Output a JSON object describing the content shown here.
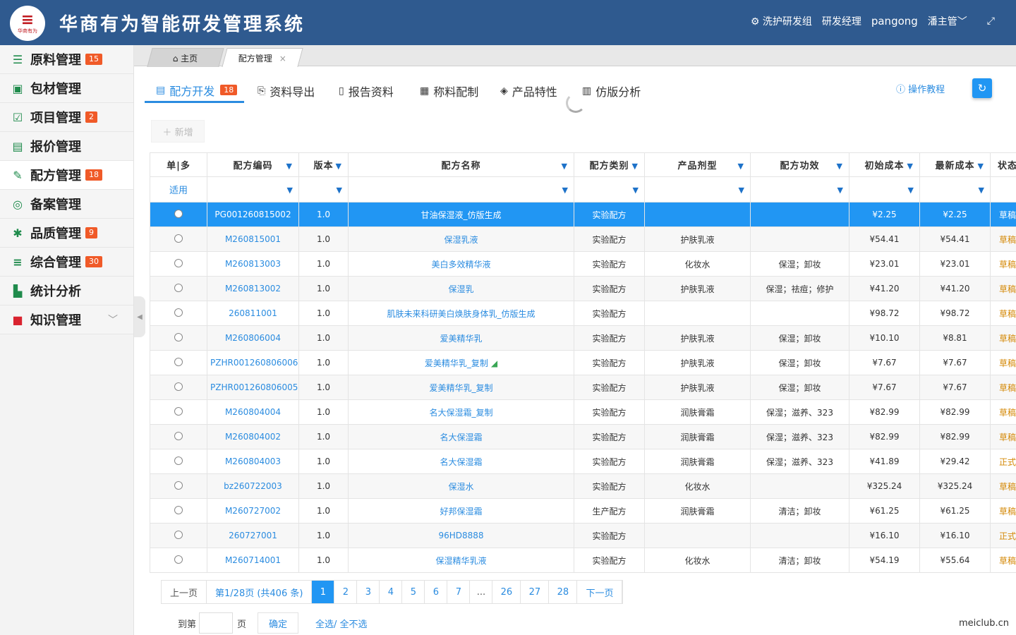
{
  "header": {
    "logo_text": "华商有为",
    "title": "华商有为智能研发管理系统",
    "group": "洗护研发组",
    "role": "研发经理",
    "username": "pangong",
    "supervisor": "潘主管"
  },
  "sidebar": {
    "items": [
      {
        "label": "原料管理",
        "badge": "15",
        "icon": "database-icon"
      },
      {
        "label": "包材管理",
        "badge": "",
        "icon": "gift-icon"
      },
      {
        "label": "项目管理",
        "badge": "2",
        "icon": "checkbox-icon"
      },
      {
        "label": "报价管理",
        "badge": "",
        "icon": "ledger-icon"
      },
      {
        "label": "配方管理",
        "badge": "18",
        "icon": "edit-icon"
      },
      {
        "label": "备案管理",
        "badge": "",
        "icon": "target-icon"
      },
      {
        "label": "品质管理",
        "badge": "9",
        "icon": "gear-icon"
      },
      {
        "label": "综合管理",
        "badge": "30",
        "icon": "list-icon"
      },
      {
        "label": "统计分析",
        "badge": "",
        "icon": "chart-icon"
      },
      {
        "label": "知识管理",
        "badge": "",
        "icon": "book-icon"
      }
    ]
  },
  "tabs": {
    "home": "主页",
    "current": "配方管理",
    "close": "×"
  },
  "subtabs": {
    "dev": "配方开发",
    "dev_badge": "18",
    "export": "资料导出",
    "report": "报告资料",
    "weigh": "称料配制",
    "feature": "产品特性",
    "imitate": "仿版分析",
    "tutorial": "操作教程"
  },
  "toolbar": {
    "add": "新增"
  },
  "table": {
    "columns": [
      "单|多",
      "配方编码",
      "版本",
      "配方名称",
      "配方类别",
      "产品剂型",
      "配方功效",
      "初始成本",
      "最新成本",
      "状态"
    ],
    "apply_label": "适用",
    "rows": [
      {
        "code": "PG001260815002",
        "ver": "1.0",
        "name": "甘油保湿液_仿版生成",
        "cat": "实验配方",
        "form": "",
        "effect": "",
        "init": "¥2.25",
        "latest": "¥2.25",
        "status": "草稿"
      },
      {
        "code": "M260815001",
        "ver": "1.0",
        "name": "保湿乳液",
        "cat": "实验配方",
        "form": "护肤乳液",
        "effect": "",
        "init": "¥54.41",
        "latest": "¥54.41",
        "status": "草稿"
      },
      {
        "code": "M260813003",
        "ver": "1.0",
        "name": "美白多效精华液",
        "cat": "实验配方",
        "form": "化妆水",
        "effect": "保湿；卸妆",
        "init": "¥23.01",
        "latest": "¥23.01",
        "status": "草稿"
      },
      {
        "code": "M260813002",
        "ver": "1.0",
        "name": "保湿乳",
        "cat": "实验配方",
        "form": "护肤乳液",
        "effect": "保湿；祛痘；修护",
        "init": "¥41.20",
        "latest": "¥41.20",
        "status": "草稿"
      },
      {
        "code": "260811001",
        "ver": "1.0",
        "name": "肌肤未来科研美白焕肤身体乳_仿版生成",
        "cat": "实验配方",
        "form": "",
        "effect": "",
        "init": "¥98.72",
        "latest": "¥98.72",
        "status": "草稿"
      },
      {
        "code": "M260806004",
        "ver": "1.0",
        "name": "爱美精华乳",
        "cat": "实验配方",
        "form": "护肤乳液",
        "effect": "保湿；卸妆",
        "init": "¥10.10",
        "latest": "¥8.81",
        "status": "草稿"
      },
      {
        "code": "PZHR001260806006",
        "ver": "1.0",
        "name": "爱美精华乳_复制",
        "cat": "实验配方",
        "form": "护肤乳液",
        "effect": "保湿；卸妆",
        "init": "¥7.67",
        "latest": "¥7.67",
        "status": "草稿",
        "edit": true
      },
      {
        "code": "PZHR001260806005",
        "ver": "1.0",
        "name": "爱美精华乳_复制",
        "cat": "实验配方",
        "form": "护肤乳液",
        "effect": "保湿；卸妆",
        "init": "¥7.67",
        "latest": "¥7.67",
        "status": "草稿"
      },
      {
        "code": "M260804004",
        "ver": "1.0",
        "name": "名大保湿霜_复制",
        "cat": "实验配方",
        "form": "润肤膏霜",
        "effect": "保湿；滋养、323",
        "init": "¥82.99",
        "latest": "¥82.99",
        "status": "草稿"
      },
      {
        "code": "M260804002",
        "ver": "1.0",
        "name": "名大保湿霜",
        "cat": "实验配方",
        "form": "润肤膏霜",
        "effect": "保湿；滋养、323",
        "init": "¥82.99",
        "latest": "¥82.99",
        "status": "草稿"
      },
      {
        "code": "M260804003",
        "ver": "1.0",
        "name": "名大保湿霜",
        "cat": "实验配方",
        "form": "润肤膏霜",
        "effect": "保湿；滋养、323",
        "init": "¥41.89",
        "latest": "¥29.42",
        "status": "正式"
      },
      {
        "code": "bz260722003",
        "ver": "1.0",
        "name": "保湿水",
        "cat": "实验配方",
        "form": "化妆水",
        "effect": "",
        "init": "¥325.24",
        "latest": "¥325.24",
        "status": "草稿"
      },
      {
        "code": "M260727002",
        "ver": "1.0",
        "name": "好邦保湿霜",
        "cat": "生产配方",
        "form": "润肤膏霜",
        "effect": "清洁；卸妆",
        "init": "¥61.25",
        "latest": "¥61.25",
        "status": "草稿"
      },
      {
        "code": "260727001",
        "ver": "1.0",
        "name": "96HD8888",
        "cat": "实验配方",
        "form": "",
        "effect": "",
        "init": "¥16.10",
        "latest": "¥16.10",
        "status": "正式"
      },
      {
        "code": "M260714001",
        "ver": "1.0",
        "name": "保湿精华乳液",
        "cat": "实验配方",
        "form": "化妆水",
        "effect": "清洁；卸妆",
        "init": "¥54.19",
        "latest": "¥55.64",
        "status": "草稿"
      }
    ]
  },
  "pager": {
    "prev": "上一页",
    "info": "第1/28页 (共406 条)",
    "pages": [
      "1",
      "2",
      "3",
      "4",
      "5",
      "6",
      "7",
      "...",
      "26",
      "27",
      "28"
    ],
    "next": "下一页",
    "goto_prefix": "到第",
    "goto_suffix": "页",
    "confirm": "确定",
    "select_all": "全选/ 全不选"
  },
  "watermark": "meiclub.cn",
  "colors": {
    "header_bg": "#2f5a8f",
    "accent": "#2196f3",
    "badge": "#f05a28",
    "icon_green": "#1f8b4c"
  }
}
